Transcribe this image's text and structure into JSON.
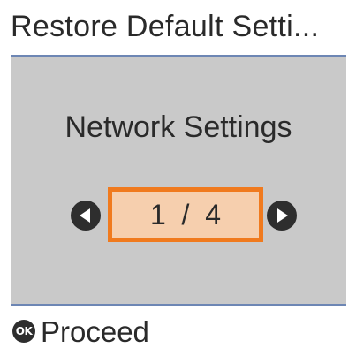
{
  "title": "Restore Default Setti...",
  "setting": {
    "name": "Network Settings"
  },
  "pager": {
    "current": 1,
    "total": 4,
    "display": "1  /  4"
  },
  "footer": {
    "ok_icon_label": "OK",
    "action_label": "Proceed"
  },
  "icons": {
    "prev": "left-arrow-circle-icon",
    "next": "right-arrow-circle-icon",
    "ok": "ok-button-icon"
  },
  "colors": {
    "panel_background": "#c9c9c9",
    "rule": "#6d86b4",
    "highlight_border": "#f07a1e",
    "highlight_fill": "#f6cfae"
  }
}
